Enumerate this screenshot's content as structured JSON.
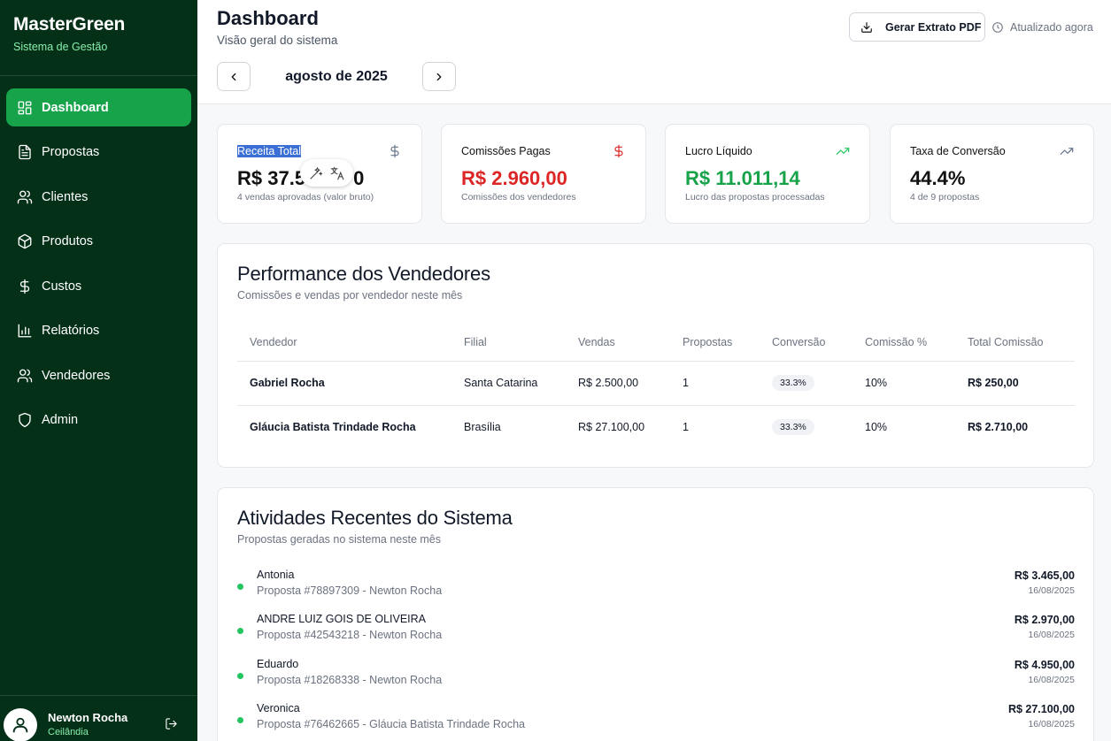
{
  "app": {
    "name": "MasterGreen",
    "subtitle": "Sistema de Gestão"
  },
  "sidebar": {
    "items": [
      {
        "label": "Dashboard",
        "icon": "dashboard-icon",
        "active": true
      },
      {
        "label": "Propostas",
        "icon": "file-icon"
      },
      {
        "label": "Clientes",
        "icon": "users-icon"
      },
      {
        "label": "Produtos",
        "icon": "box-icon"
      },
      {
        "label": "Custos",
        "icon": "dollar-icon"
      },
      {
        "label": "Relatórios",
        "icon": "bar-chart-icon"
      },
      {
        "label": "Vendedores",
        "icon": "users-icon"
      },
      {
        "label": "Admin",
        "icon": "shield-icon"
      }
    ]
  },
  "user": {
    "name": "Newton Rocha",
    "location": "Ceilândia"
  },
  "header": {
    "title": "Dashboard",
    "subtitle": "Visão geral do sistema",
    "month": "agosto de 2025",
    "pdf_button": "Gerar Extrato PDF",
    "updated": "Atualizado agora"
  },
  "stats": [
    {
      "label": "Receita Total",
      "value": "R$ 37.5",
      "value_tail": "0",
      "desc": "4 vendas aprovadas (valor bruto)",
      "icon": "dollar-icon",
      "color": "#111111",
      "icon_color": "#64748b"
    },
    {
      "label": "Comissões Pagas",
      "value": "R$ 2.960,00",
      "desc": "Comissões dos vendedores",
      "icon": "dollar-icon",
      "color": "#dc2626",
      "icon_color": "#dc2626"
    },
    {
      "label": "Lucro Líquido",
      "value": "R$ 11.011,14",
      "desc": "Lucro das propostas processadas",
      "icon": "trending-up-icon",
      "color": "#16a34a",
      "icon_color": "#22c55e"
    },
    {
      "label": "Taxa de Conversão",
      "value": "44.4%",
      "desc": "4 de 9 propostas",
      "icon": "trending-up-icon",
      "color": "#111111",
      "icon_color": "#64748b"
    }
  ],
  "performance": {
    "title": "Performance dos Vendedores",
    "subtitle": "Comissões e vendas por vendedor neste mês",
    "columns": [
      "Vendedor",
      "Filial",
      "Vendas",
      "Propostas",
      "Conversão",
      "Comissão %",
      "Total Comissão"
    ],
    "rows": [
      [
        "Gabriel Rocha",
        "Santa Catarina",
        "R$ 2.500,00",
        "1",
        "33.3%",
        "10%",
        "R$ 250,00"
      ],
      [
        "Gláucia Batista Trindade Rocha",
        "Brasília",
        "R$ 27.100,00",
        "1",
        "33.3%",
        "10%",
        "R$ 2.710,00"
      ]
    ]
  },
  "activities": {
    "title": "Atividades Recentes do Sistema",
    "subtitle": "Propostas geradas no sistema neste mês",
    "items": [
      {
        "name": "Antonia",
        "desc": "Proposta #78897309 - Newton Rocha",
        "amount": "R$ 3.465,00",
        "date": "16/08/2025"
      },
      {
        "name": "ANDRE LUIZ GOIS DE OLIVEIRA",
        "desc": "Proposta #42543218 - Newton Rocha",
        "amount": "R$ 2.970,00",
        "date": "16/08/2025"
      },
      {
        "name": "Eduardo",
        "desc": "Proposta #18268338 - Newton Rocha",
        "amount": "R$ 4.950,00",
        "date": "16/08/2025"
      },
      {
        "name": "Veronica",
        "desc": "Proposta #76462665 - Gláucia Batista Trindade Rocha",
        "amount": "R$ 27.100,00",
        "date": "16/08/2025"
      }
    ]
  }
}
